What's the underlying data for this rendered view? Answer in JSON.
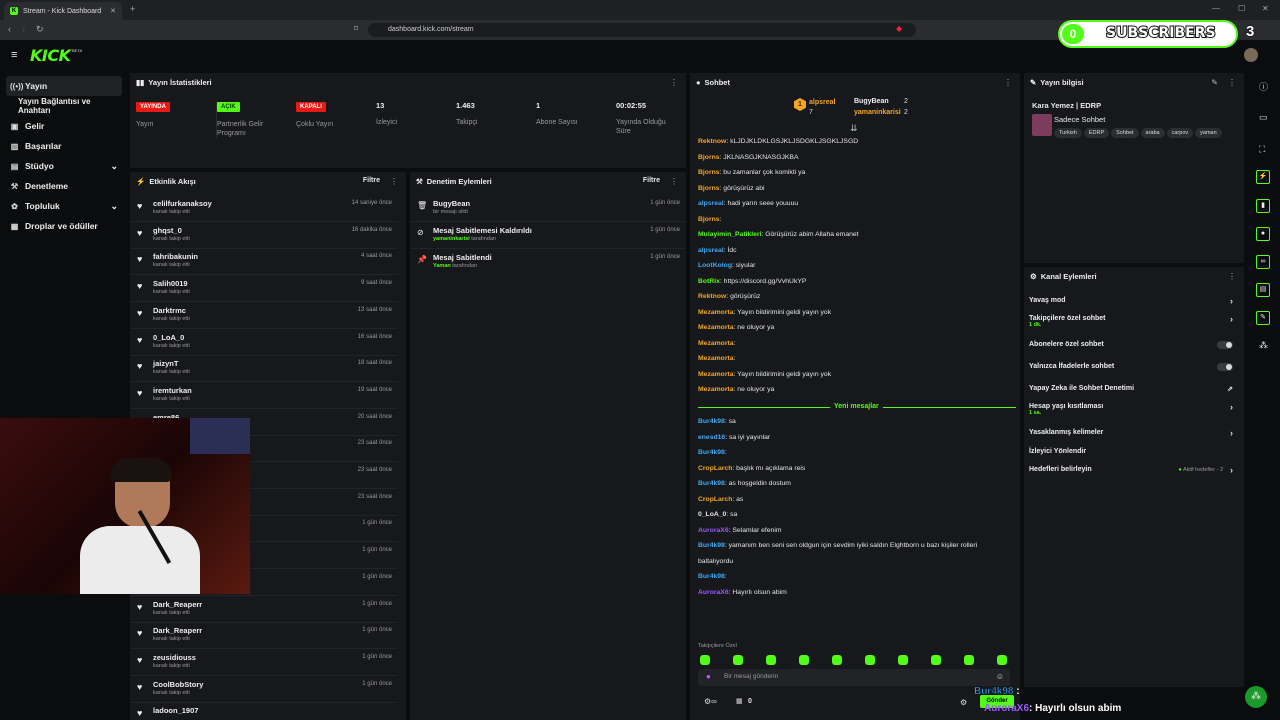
{
  "browser": {
    "tab_title": "Stream - Kick Dashboard",
    "url": "dashboard.kick.com/stream"
  },
  "overlay": {
    "sub_count_left": "0",
    "sub_label": "SUBSCRIBERS",
    "sub_count_right": "3",
    "bottom_user1": "Bur4k98",
    "bottom_user2": "AuroraX6",
    "bottom_msg": ": Hayırlı olsun abim",
    "send_btn": "Gönder"
  },
  "header": {
    "logo": "KICK",
    "beta": "BETA"
  },
  "sidebar": {
    "items": [
      {
        "label": "Yayın",
        "icon": "broadcast-icon"
      },
      {
        "label": "Yayın Bağlantısı ve Anahtarı",
        "icon": ""
      },
      {
        "label": "Gelir",
        "icon": "dollar-icon"
      },
      {
        "label": "Başarılar",
        "icon": "trophy-icon"
      },
      {
        "label": "Stüdyo",
        "icon": "studio-icon"
      },
      {
        "label": "Denetleme",
        "icon": "hammer-icon"
      },
      {
        "label": "Topluluk",
        "icon": "community-icon"
      },
      {
        "label": "Droplar ve ödüller",
        "icon": "gift-icon"
      }
    ]
  },
  "stats": {
    "title": "Yayın İstatistikleri",
    "cols": [
      {
        "value": "YAYINDA",
        "label": "Yayın",
        "badge": "#e91916"
      },
      {
        "value": "AÇIK",
        "label": "Partnerlik Gelir Programı",
        "badge": "#53fc18"
      },
      {
        "value": "KAPALI",
        "label": "Çoklu Yayın",
        "badge": "#e91916"
      },
      {
        "value": "13",
        "label": "İzleyici"
      },
      {
        "value": "1.463",
        "label": "Takipçi"
      },
      {
        "value": "1",
        "label": "Abone Sayısı"
      },
      {
        "value": "00:02:55",
        "label": "Yayında Olduğu Süre"
      }
    ]
  },
  "activity": {
    "title": "Etkinlik Akışı",
    "filter": "Filtre",
    "items": [
      {
        "name": "celilfurkanaksoy",
        "sub": "kanalı takip etti",
        "time": "14 saniye önce"
      },
      {
        "name": "ghqst_0",
        "sub": "kanalı takip etti",
        "time": "16 dakika önce"
      },
      {
        "name": "fahribakunin",
        "sub": "kanalı takip etti",
        "time": "4 saat önce"
      },
      {
        "name": "Salih0019",
        "sub": "kanalı takip etti",
        "time": "9 saat önce"
      },
      {
        "name": "Darktrmc",
        "sub": "kanalı takip etti",
        "time": "13 saat önce"
      },
      {
        "name": "0_LoA_0",
        "sub": "kanalı takip etti",
        "time": "16 saat önce"
      },
      {
        "name": "jaizynT",
        "sub": "kanalı takip etti",
        "time": "18 saat önce"
      },
      {
        "name": "iremturkan",
        "sub": "kanalı takip etti",
        "time": "19 saat önce"
      },
      {
        "name": "emre86",
        "sub": "",
        "time": "20 saat önce"
      },
      {
        "name": "",
        "sub": "",
        "time": "23 saat önce"
      },
      {
        "name": "",
        "sub": "",
        "time": "23 saat önce"
      },
      {
        "name": "",
        "sub": "",
        "time": "23 saat önce"
      },
      {
        "name": "",
        "sub": "",
        "time": "1 gün önce"
      },
      {
        "name": "",
        "sub": "",
        "time": "1 gün önce"
      },
      {
        "name": "",
        "sub": "",
        "time": "1 gün önce"
      },
      {
        "name": "Dark_Reaperr",
        "sub": "kanalı takip etti",
        "time": "1 gün önce"
      },
      {
        "name": "Dark_Reaperr",
        "sub": "kanalı takip etti",
        "time": "1 gün önce"
      },
      {
        "name": "zeusidiouss",
        "sub": "kanalı takip etti",
        "time": "1 gün önce"
      },
      {
        "name": "CoolBobStory",
        "sub": "kanalı takip etti",
        "time": "1 gün önce"
      },
      {
        "name": "ladoon_1907",
        "sub": "",
        "time": ""
      }
    ]
  },
  "moderation": {
    "title": "Denetim Eylemleri",
    "filter": "Filtre",
    "items": [
      {
        "title": "BugyBean",
        "by": "",
        "sub": "bir mesajı sildi",
        "time": "1 gün önce"
      },
      {
        "title": "Mesaj Sabitlemesi Kaldırıldı",
        "by": "yamaninkarisi",
        "sub": " tarafından",
        "time": "1 gün önce"
      },
      {
        "title": "Mesaj Sabitlendi",
        "by": "Yaman",
        "sub": " tarafından",
        "time": "1 gün önce"
      }
    ]
  },
  "chat": {
    "title": "Sohbet",
    "top": [
      {
        "rank": "1",
        "name": "alpsreal",
        "count": "7"
      },
      {
        "rank": "",
        "name": "BugyBean",
        "count": "2"
      },
      {
        "rank": "",
        "name": "yamaninkarisi",
        "count": "2"
      }
    ],
    "messages": [
      {
        "user": "Rektnow",
        "color": "#f5a623",
        "text": ": kLJDJKLDKLGSJKLJSDGKLJSGKLJSGD"
      },
      {
        "user": "Bjorns",
        "color": "#f5a623",
        "text": ": JKLNASGJKNASGJKBA"
      },
      {
        "user": "Bjorns",
        "color": "#f5a623",
        "text": ": bu zamanlar çok komikti ya"
      },
      {
        "user": "Bjorns",
        "color": "#f5a623",
        "text": ": görüşürüz abi"
      },
      {
        "user": "alpsreal",
        "color": "#3fa9f5",
        "text": ": hadi yarın seee youuuu"
      },
      {
        "user": "Bjorns",
        "color": "#f5a623",
        "text": ":"
      },
      {
        "user": "Mulayimin_Patikleri",
        "color": "#53fc18",
        "text": ": Görüşürüz abim Allaha emanet"
      },
      {
        "user": "alpsreal",
        "color": "#3fa9f5",
        "text": ": İdc"
      },
      {
        "user": "LootKolog",
        "color": "#3fa9f5",
        "text": ": siyular"
      },
      {
        "user": "BotRix",
        "color": "#53fc18",
        "text": ": https://discord.gg/VvhUkYP"
      },
      {
        "user": "Rektnow",
        "color": "#f5a623",
        "text": ": görüşürüz"
      },
      {
        "user": "Mezamorta",
        "color": "#f5a623",
        "text": ": Yayın bildirimini geldi yayın yok"
      },
      {
        "user": "Mezamorta",
        "color": "#f5a623",
        "text": ": ne oluyor ya"
      },
      {
        "user": "Mezamorta",
        "color": "#f5a623",
        "text": ":"
      },
      {
        "user": "Mezamorta",
        "color": "#f5a623",
        "text": ":"
      },
      {
        "user": "Mezamorta",
        "color": "#f5a623",
        "text": ": Yayın bildirimini geldi yayın yok"
      },
      {
        "user": "Mezamorta",
        "color": "#f5a623",
        "text": ": ne oluyor ya"
      }
    ],
    "new_messages": "Yeni mesajlar",
    "messages2": [
      {
        "user": "Bur4k98",
        "color": "#3fa9f5",
        "text": ": sa"
      },
      {
        "user": "enesd16",
        "color": "#3fa9f5",
        "text": ": sa iyi yayınlar"
      },
      {
        "user": "Bur4k98",
        "color": "#3fa9f5",
        "text": ":"
      },
      {
        "user": "CropLarch",
        "color": "#f5a623",
        "text": ": başlık mı açıklama reis"
      },
      {
        "user": "Bur4k98",
        "color": "#3fa9f5",
        "text": ": as hoşgeldin dostum"
      },
      {
        "user": "CropLarch",
        "color": "#f5a623",
        "text": ": as"
      },
      {
        "user": "0_LoA_0",
        "color": "#e8e8e8",
        "text": ": sa"
      },
      {
        "user": "AuroraX6",
        "color": "#9b59ff",
        "text": ": Selamlar efenim"
      },
      {
        "user": "Bur4k98",
        "color": "#3fa9f5",
        "text": ": yamanım ben seni sen oldgun için sevdim iyiki saldın Elghtborn u bazı kişiler rolleri"
      },
      {
        "user": "",
        "color": "#e8e8e8",
        "text": "baltalıyordu"
      },
      {
        "user": "Bur4k98",
        "color": "#3fa9f5",
        "text": ":"
      },
      {
        "user": "AuroraX6",
        "color": "#9b59ff",
        "text": ": Hayırlı olsun abim"
      }
    ],
    "followers_only": "Takipçilere Özel",
    "input_placeholder": "Bir mesaj gönderin",
    "viewer_count": "0"
  },
  "stream_info": {
    "title": "Yayın bilgisi",
    "stream_title": "Kara Yemez | EDRP",
    "category": "Sadece Sohbet",
    "tags": [
      "Turkish",
      "EDRP",
      "Sohbet",
      "araba",
      "carpov",
      "yaman"
    ]
  },
  "channel_actions": {
    "title": "Kanal Eylemleri",
    "rows": [
      {
        "label": "Yavaş mod",
        "sub": "",
        "ctl": "chevron"
      },
      {
        "label": "Takipçilere özel sohbet",
        "sub": "1 dk.",
        "ctl": "chevron"
      },
      {
        "label": "Abonelere özel sohbet",
        "sub": "",
        "ctl": "toggle"
      },
      {
        "label": "Yalnızca İfadelerle sohbet",
        "sub": "",
        "ctl": "toggle"
      },
      {
        "label": "Yapay Zeka ile Sohbet Denetimi",
        "sub": "",
        "ctl": "external"
      },
      {
        "label": "Hesap yaşı kısıtlaması",
        "sub": "1 sa.",
        "ctl": "chevron"
      },
      {
        "label": "Yasaklanmış kelimeler",
        "sub": "",
        "ctl": "chevron"
      },
      {
        "label": "İzleyici Yönlendir",
        "sub": "",
        "ctl": "none"
      },
      {
        "label": "Hedefleri belirleyin",
        "sub": "",
        "ctl": "chevron",
        "right": "Aktif hedefler - 2"
      }
    ]
  },
  "colors": {
    "accent": "#53fc18",
    "live": "#e91916",
    "panel": "#17181b"
  }
}
